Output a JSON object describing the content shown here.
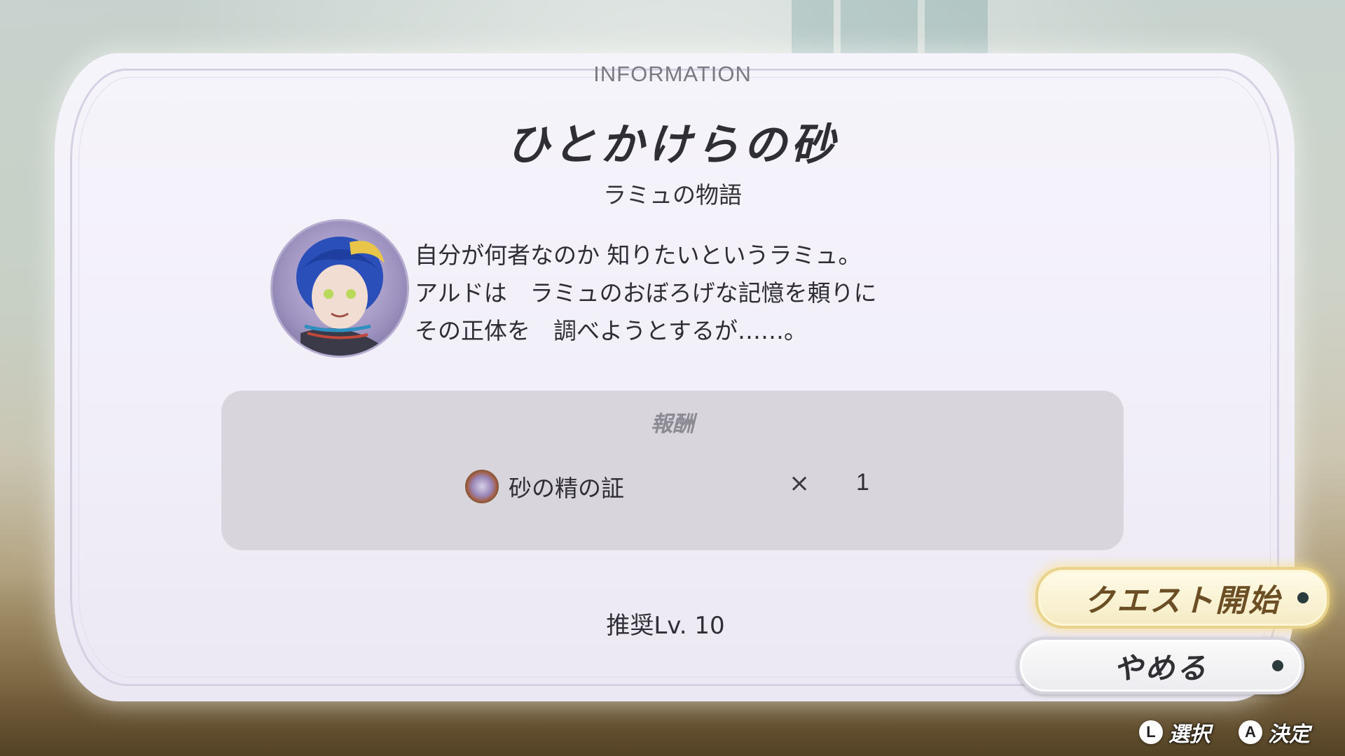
{
  "header": {
    "info_label": "INFORMATION"
  },
  "quest": {
    "title": "ひとかけらの砂",
    "subtitle": "ラミュの物語",
    "description_lines": [
      "自分が何者なのか 知りたいというラミュ。",
      "アルドは　ラミュのおぼろげな記憶を頼りに",
      "その正体を　調べようとするが……。"
    ],
    "recommended_level": "推奨Lv. 10"
  },
  "reward": {
    "title": "報酬",
    "item_name": "砂の精の証",
    "multiplier": "×",
    "quantity": "1",
    "icon": "sand-spirit-medal-icon"
  },
  "buttons": {
    "start_label": "クエスト開始",
    "cancel_label": "やめる"
  },
  "hints": {
    "select_key": "L",
    "select_label": "選択",
    "confirm_key": "A",
    "confirm_label": "決定"
  },
  "colors": {
    "panel_bg": "#f3f0f8",
    "reward_bg": "#d8d5dd",
    "start_border": "#e9d38c",
    "start_text": "#6b4e24"
  }
}
